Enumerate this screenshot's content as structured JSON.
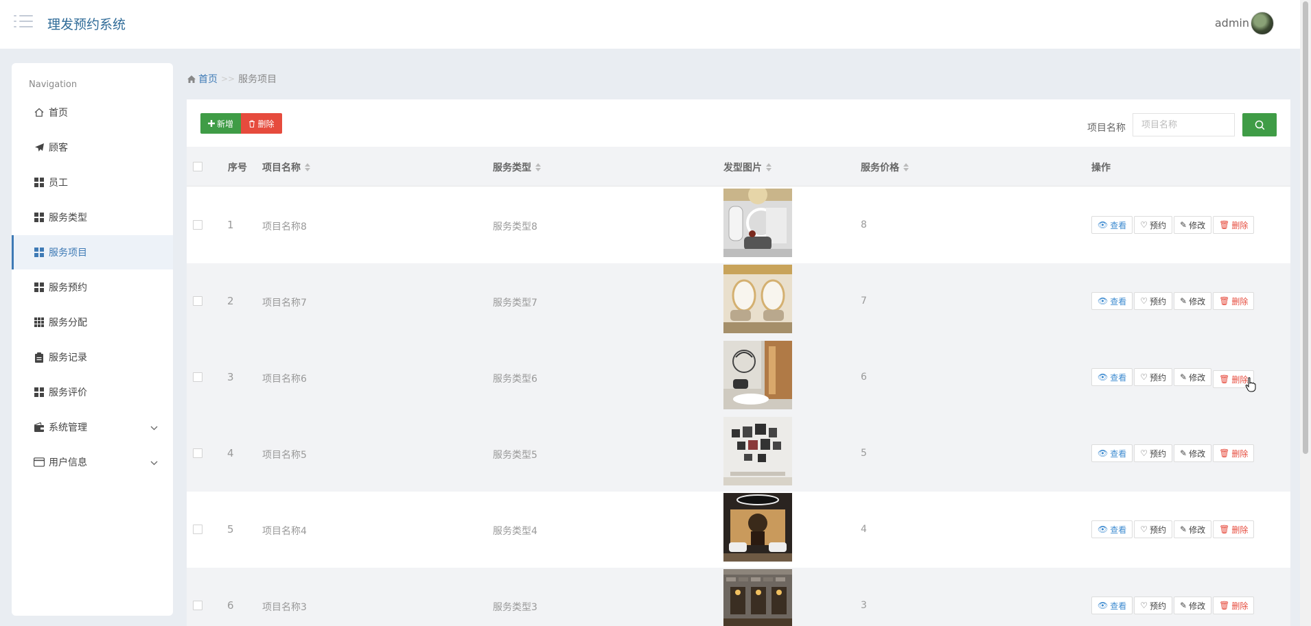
{
  "header": {
    "app_title": "理发预约系统",
    "user_name": "admin"
  },
  "sidebar": {
    "title": "Navigation",
    "items": [
      {
        "label": "首页",
        "icon": "home-icon"
      },
      {
        "label": "顾客",
        "icon": "paper-plane-icon"
      },
      {
        "label": "员工",
        "icon": "grid-icon"
      },
      {
        "label": "服务类型",
        "icon": "grid-icon"
      },
      {
        "label": "服务项目",
        "icon": "grid-icon",
        "active": true
      },
      {
        "label": "服务预约",
        "icon": "grid-icon"
      },
      {
        "label": "服务分配",
        "icon": "grid-9-icon"
      },
      {
        "label": "服务记录",
        "icon": "clipboard-icon"
      },
      {
        "label": "服务评价",
        "icon": "grid-icon"
      },
      {
        "label": "系统管理",
        "icon": "wallet-icon",
        "expandable": true
      },
      {
        "label": "用户信息",
        "icon": "id-card-icon",
        "expandable": true
      }
    ]
  },
  "breadcrumb": {
    "home": "首页",
    "separator": ">>",
    "current": "服务项目"
  },
  "toolbar": {
    "add_label": "新增",
    "delete_label": "删除"
  },
  "search": {
    "label": "项目名称",
    "placeholder": "项目名称",
    "value": ""
  },
  "table": {
    "columns": [
      "序号",
      "项目名称",
      "服务类型",
      "发型图片",
      "服务价格",
      "操作"
    ],
    "actions": {
      "view": "查看",
      "reserve": "预约",
      "edit": "修改",
      "delete": "删除"
    },
    "rows": [
      {
        "index": "1",
        "name": "项目名称8",
        "type": "服务类型8",
        "price": "8"
      },
      {
        "index": "2",
        "name": "项目名称7",
        "type": "服务类型7",
        "price": "7"
      },
      {
        "index": "3",
        "name": "项目名称6",
        "type": "服务类型6",
        "price": "6"
      },
      {
        "index": "4",
        "name": "项目名称5",
        "type": "服务类型5",
        "price": "5"
      },
      {
        "index": "5",
        "name": "项目名称4",
        "type": "服务类型4",
        "price": "4"
      },
      {
        "index": "6",
        "name": "项目名称3",
        "type": "服务类型3",
        "price": "3"
      }
    ]
  },
  "colors": {
    "brand": "#2f6b98",
    "accent_blue": "#3e7ab5",
    "success_green": "#3f9c46",
    "danger_red": "#e64b3d"
  }
}
